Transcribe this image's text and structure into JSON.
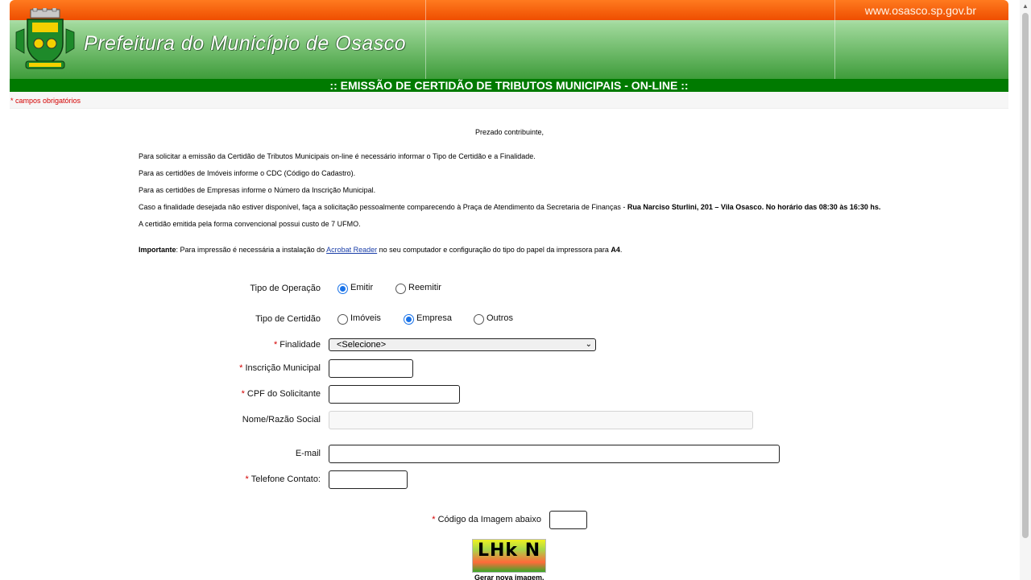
{
  "header": {
    "site_url": "www.osasco.sp.gov.br",
    "org_name": "Prefeitura do Município de Osasco",
    "title": ":: EMISSÃO DE CERTIDÃO DE TRIBUTOS MUNICIPAIS - ON-LINE ::"
  },
  "required_note": "* campos obrigatórios",
  "intro": {
    "greeting": "Prezado contribuinte,",
    "p1": "Para solicitar a emissão da Certidão de Tributos Municipais on-line é necessário informar o Tipo de Certidão e a Finalidade.",
    "p2": "Para as certidões de Imóveis informe o CDC (Código do Cadastro).",
    "p3": "Para as certidões de Empresas informe o Número da Inscrição Municipal.",
    "p4_start": "Caso a finalidade desejada não estiver disponível, faça a solicitação pessoalmente comparecendo à Praça de Atendimento da Secretaria de Finanças - ",
    "p4_bold": "Rua Narciso Sturlini, 201 – Vila Osasco. No horário das 08:30 às 16:30 hs.",
    "p5": "A certidão emitida pela forma convencional possui custo de 7 UFMO.",
    "important_label": "Importante",
    "important_text": ": Para impressão é necessária a instalação do ",
    "important_link": "Acrobat Reader",
    "important_text2": " no seu computador e configuração do tipo do papel da impressora para ",
    "important_bold": "A4",
    "important_end": "."
  },
  "form": {
    "tipo_operacao_label": "Tipo de Operação",
    "operacao_options": [
      "Emitir",
      "Reemitir"
    ],
    "operacao_selected": "Emitir",
    "tipo_certidao_label": "Tipo de Certidão",
    "certidao_options": [
      "Imóveis",
      "Empresa",
      "Outros"
    ],
    "certidao_selected": "Empresa",
    "required_mark": "*",
    "finalidade_label": "Finalidade",
    "finalidade_value": "<Selecione>",
    "inscricao_label": "Inscrição Municipal",
    "cpf_label": "CPF do Solicitante",
    "nome_label": "Nome/Razão Social",
    "email_label": "E-mail",
    "telefone_label": "Telefone Contato:",
    "captcha_label": "Código da Imagem abaixo",
    "captcha_text": "LHk N",
    "new_image_label": "Gerar nova imagem."
  },
  "colors": {
    "header_orange": "#ee4e00",
    "title_green": "#007a00",
    "required_red": "#d40000",
    "link_blue": "#1a3ea8"
  }
}
